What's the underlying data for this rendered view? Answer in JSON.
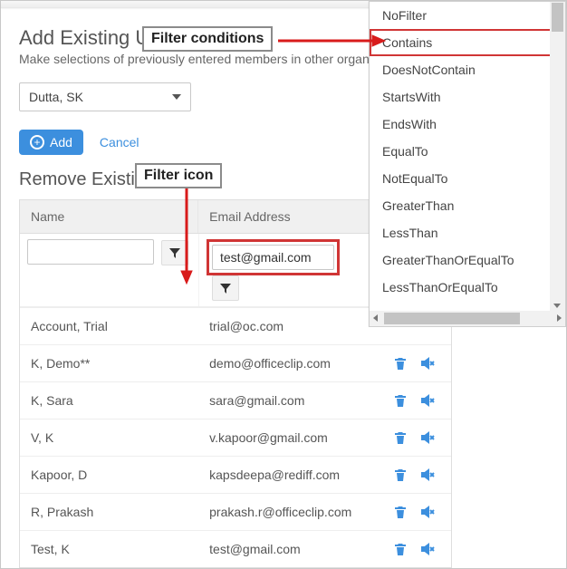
{
  "callouts": {
    "filterConditions": "Filter conditions",
    "filterIcon": "Filter icon"
  },
  "addSection": {
    "title": "Add Existing Users",
    "subtitle": "Make selections of previously entered members in other organization",
    "selectedUser": "Dutta, SK",
    "addBtn": "Add",
    "cancel": "Cancel"
  },
  "removeSection": {
    "title": "Remove Existing Users",
    "columns": {
      "name": "Name",
      "email": "Email Address"
    },
    "filter": {
      "name": "",
      "email": "test@gmail.com"
    },
    "rows": [
      {
        "name": "Account, Trial",
        "email": "trial@oc.com"
      },
      {
        "name": "K, Demo**",
        "email": "demo@officeclip.com"
      },
      {
        "name": "K, Sara",
        "email": "sara@gmail.com"
      },
      {
        "name": "V, K",
        "email": "v.kapoor@gmail.com"
      },
      {
        "name": "Kapoor, D",
        "email": "kapsdeepa@rediff.com"
      },
      {
        "name": "R, Prakash",
        "email": "prakash.r@officeclip.com"
      },
      {
        "name": "Test, K",
        "email": "test@gmail.com"
      }
    ]
  },
  "filterMenu": {
    "items": [
      "NoFilter",
      "Contains",
      "DoesNotContain",
      "StartsWith",
      "EndsWith",
      "EqualTo",
      "NotEqualTo",
      "GreaterThan",
      "LessThan",
      "GreaterThanOrEqualTo",
      "LessThanOrEqualTo"
    ],
    "selectedIndex": 1
  }
}
